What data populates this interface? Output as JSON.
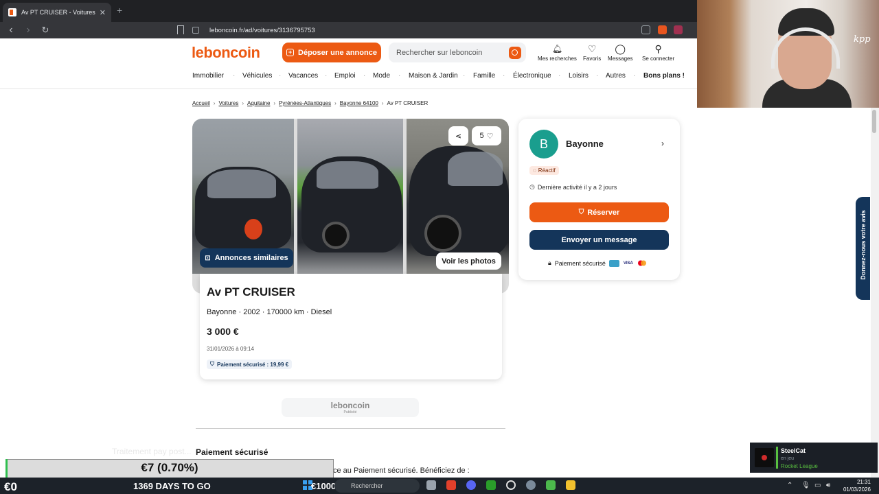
{
  "browser": {
    "tab_title": "Av PT CRUISER - Voitures",
    "tab_close": "✕",
    "new_tab": "+",
    "url": "leboncoin.fr/ad/voitures/3136795753",
    "back": "‹",
    "forward": "›",
    "reload": "↻"
  },
  "header": {
    "logo": "leboncoin",
    "post_button": "Déposer une annonce",
    "search_placeholder": "Rechercher sur leboncoin",
    "icons": [
      {
        "label": "Mes recherches",
        "icon": "bell-icon",
        "glyph": "🔔"
      },
      {
        "label": "Favoris",
        "icon": "heart-icon",
        "glyph": "♡"
      },
      {
        "label": "Messages",
        "icon": "chat-icon",
        "glyph": "💬"
      },
      {
        "label": "Se connecter",
        "icon": "user-icon",
        "glyph": "👤"
      }
    ],
    "categories": [
      "Immobilier",
      "Véhicules",
      "Vacances",
      "Emploi",
      "Mode",
      "Maison & Jardin",
      "Famille",
      "Électronique",
      "Loisirs",
      "Autres",
      "Bons plans !"
    ]
  },
  "breadcrumb": [
    "Accueil",
    "Voitures",
    "Aquitaine",
    "Pyrénées-Atlantiques",
    "Bayonne 64100",
    "Av PT CRUISER"
  ],
  "gallery": {
    "similar_button": "Annonces similaires",
    "see_photos_button": "Voir les photos",
    "favorites_count": "5"
  },
  "ad": {
    "title": "Av PT CRUISER",
    "subtitle": "Bayonne · 2002 · 170000 km · Diesel",
    "price": "3 000 €",
    "date": "31/01/2026 à 09:14",
    "secure_badge": "Paiement sécurisé : 19,99 €"
  },
  "seller": {
    "initial": "B",
    "name": "Bayonne",
    "badge": "Réactif",
    "last_activity": "Dernière activité il y a 2 jours",
    "reserve_button": "Réserver",
    "message_button": "Envoyer un message",
    "secure_payment": "Paiement sécurisé",
    "card_visa": "VISA"
  },
  "feedback_tab": "Donnez-nous votre avis",
  "ad_block": {
    "logo": "leboncoin",
    "label": "Publicité"
  },
  "payment_section": {
    "title": "Paiement sécurisé",
    "text": "ce au Paiement sécurisé. Bénéficiez de :"
  },
  "stream_overlay": {
    "ghost_text": "Traitement pay post...",
    "value_change": "€7 (0.70%)",
    "balance": "€0",
    "days": "1369 DAYS TO GO",
    "target": "€1000"
  },
  "steam": {
    "name": "SteelCat",
    "status": "en jeu",
    "game": "Rocket League"
  },
  "taskbar": {
    "search_label": "Rechercher",
    "time": "21:31",
    "date": "01/03/2026"
  },
  "colors": {
    "brand_orange": "#ec5a13",
    "navy": "#14355a",
    "avatar_teal": "#1a9e8e"
  }
}
